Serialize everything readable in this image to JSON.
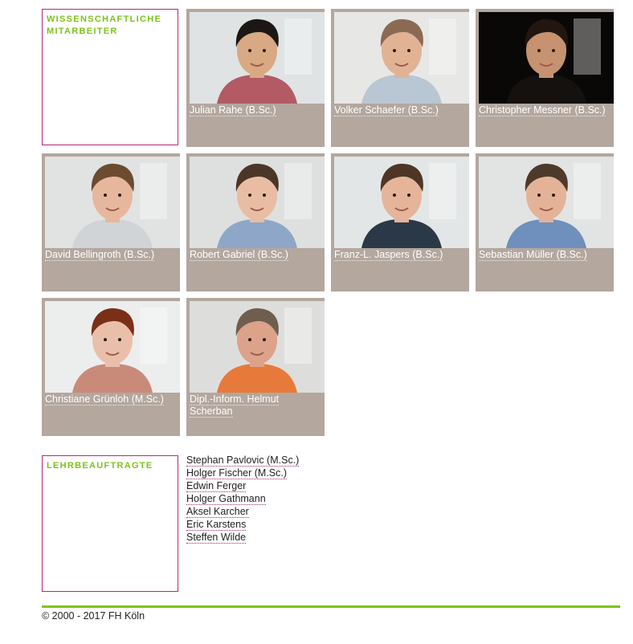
{
  "sections": {
    "staff_title": "Wissenschaftliche Mitarbeiter",
    "lecturers_title": "Lehrbeauftragte"
  },
  "staff": [
    {
      "name": "Julian Rahe (B.Sc.)",
      "bg": "#dfe3e4",
      "skin": "#d8a982",
      "hair": "#1b1714",
      "shirt": "#b35a65"
    },
    {
      "name": "Volker Schaefer (B.Sc.)",
      "bg": "#e7e7e5",
      "skin": "#e2b295",
      "hair": "#8a6a52",
      "shirt": "#b9c6d3"
    },
    {
      "name": "Christopher Messner (B.Sc.)",
      "bg": "#0a0807",
      "skin": "#c7926f",
      "hair": "#221610",
      "shirt": "#14110f"
    },
    {
      "name": "David Bellingroth (B.Sc.)",
      "bg": "#e1e3e2",
      "skin": "#e7b79d",
      "hair": "#6c4b30",
      "shirt": "#d0d4d7"
    },
    {
      "name": "Robert Gabriel (B.Sc.)",
      "bg": "#dee0df",
      "skin": "#e8bda4",
      "hair": "#4b3727",
      "shirt": "#8ea7c8"
    },
    {
      "name": "Franz-L. Jaspers (B.Sc.)",
      "bg": "#e3e6e7",
      "skin": "#e5b499",
      "hair": "#4d3625",
      "shirt": "#2b3848"
    },
    {
      "name": "Sebastian Müller (B.Sc.)",
      "bg": "#e2e4e3",
      "skin": "#e4b397",
      "hair": "#4e3a2a",
      "shirt": "#6f8fbc"
    },
    {
      "name": "Christiane Grünloh (M.Sc.)",
      "bg": "#eceded",
      "skin": "#e9bfaa",
      "hair": "#7a2f18",
      "shirt": "#c98a7a"
    },
    {
      "name": "Dipl.-Inform. Helmut Scherban",
      "bg": "#dddedc",
      "skin": "#dca28a",
      "hair": "#6f5e4e",
      "shirt": "#e77a3a"
    }
  ],
  "lecturers": [
    "Stephan Pavlovic (M.Sc.)",
    "Holger Fischer (M.Sc.)",
    "Edwin Ferger",
    "Holger Gathmann",
    "Aksel Karcher",
    "Eric Karstens",
    "Steffen Wilde"
  ],
  "footer": {
    "copyright": "© 2000 - 2017 FH Köln"
  }
}
